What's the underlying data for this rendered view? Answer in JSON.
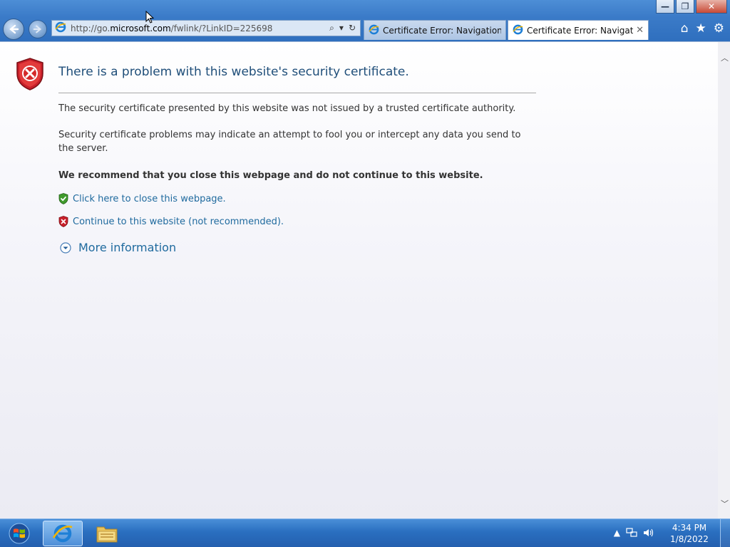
{
  "window": {
    "minimize_glyph": "—",
    "restore_glyph": "❐",
    "close_glyph": "✕"
  },
  "addressbar": {
    "url_prefix": "http://go.",
    "url_domain": "microsoft.com",
    "url_suffix": "/fwlink/?LinkID=225698",
    "search_glyph": "⌕",
    "dropdown_glyph": "▾",
    "refresh_glyph": "↻"
  },
  "tabs": [
    {
      "label": "Certificate Error: Navigation Bl...",
      "active": false
    },
    {
      "label": "Certificate Error: Navigation...",
      "active": true,
      "close_glyph": "✕"
    }
  ],
  "toolbar_right": {
    "home_glyph": "⌂",
    "favorites_glyph": "★",
    "tools_glyph": "⚙"
  },
  "page": {
    "title": "There is a problem with this website's security certificate.",
    "paragraph1": "The security certificate presented by this website was not issued by a trusted certificate authority.",
    "paragraph2": "Security certificate problems may indicate an attempt to fool you or intercept any data you send to the server.",
    "recommendation": "We recommend that you close this webpage and do not continue to this website.",
    "close_link": "Click here to close this webpage.",
    "continue_link": "Continue to this website (not recommended).",
    "more_info": "More information"
  },
  "taskbar": {
    "time": "4:34 PM",
    "date": "1/8/2022",
    "tray_arrow": "▲"
  },
  "colors": {
    "link": "#1f6a9e",
    "title": "#1f4e79",
    "shield_red": "#c8202a",
    "shield_green": "#3f9a2c",
    "taskbar": "#2a6fc0"
  }
}
